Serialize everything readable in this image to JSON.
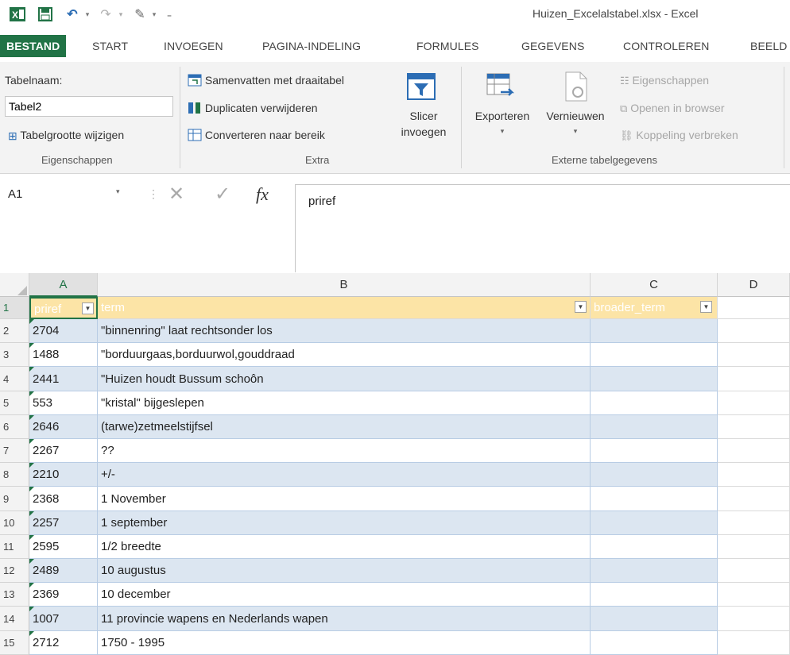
{
  "titlebar": {
    "title": "Huizen_Excelalstabel.xlsx - Excel",
    "icons": [
      "excel-icon",
      "save-icon",
      "undo-icon",
      "redo-icon",
      "brush-icon",
      "customize-icon"
    ]
  },
  "tabs": [
    "BESTAND",
    "START",
    "INVOEGEN",
    "PAGINA-INDELING",
    "FORMULES",
    "GEGEVENS",
    "CONTROLEREN",
    "BEELD"
  ],
  "ribbon": {
    "eigenschappen": {
      "name_label": "Tabelnaam:",
      "name_value": "Tabel2",
      "resize": "Tabelgrootte wijzigen",
      "group": "Eigenschappen"
    },
    "extra": {
      "pivot": "Samenvatten met draaitabel",
      "dedupe": "Duplicaten verwijderen",
      "convert": "Converteren naar bereik",
      "slicer_1": "Slicer",
      "slicer_2": "invoegen",
      "group": "Extra"
    },
    "extern": {
      "export": "Exporteren",
      "refresh": "Vernieuwen",
      "props": "Eigenschappen",
      "open_browser": "Openen in browser",
      "unlink": "Koppeling verbreken",
      "group": "Externe tabelgegevens"
    }
  },
  "formula_bar": {
    "name_box": "A1",
    "cancel": "✕",
    "confirm": "✓",
    "fx": "fx",
    "value": "priref"
  },
  "columns": [
    "A",
    "B",
    "C",
    "D"
  ],
  "headers": [
    "priref",
    "term",
    "broader_term"
  ],
  "rows": [
    {
      "n": "2",
      "a": "2704",
      "b": "\"binnenring\" laat rechtsonder los"
    },
    {
      "n": "3",
      "a": "1488",
      "b": "\"borduurgaas,borduurwol,gouddraad"
    },
    {
      "n": "4",
      "a": "2441",
      "b": "\"Huizen houdt Bussum schoôn"
    },
    {
      "n": "5",
      "a": "553",
      "b": "\"kristal\" bijgeslepen"
    },
    {
      "n": "6",
      "a": "2646",
      "b": "(tarwe)zetmeelstijfsel"
    },
    {
      "n": "7",
      "a": "2267",
      "b": "??"
    },
    {
      "n": "8",
      "a": "2210",
      "b": "+/-"
    },
    {
      "n": "9",
      "a": "2368",
      "b": "1 November"
    },
    {
      "n": "10",
      "a": "2257",
      "b": "1 september"
    },
    {
      "n": "11",
      "a": "2595",
      "b": "1/2 breedte"
    },
    {
      "n": "12",
      "a": "2489",
      "b": "10 augustus"
    },
    {
      "n": "13",
      "a": "2369",
      "b": "10 december"
    },
    {
      "n": "14",
      "a": "1007",
      "b": "11 provincie wapens en Nederlands wapen"
    },
    {
      "n": "15",
      "a": "2712",
      "b": "1750 - 1995"
    }
  ],
  "colors": {
    "accent": "#217346",
    "header_fill": "#fce4a6",
    "band_fill": "#dce6f1"
  }
}
